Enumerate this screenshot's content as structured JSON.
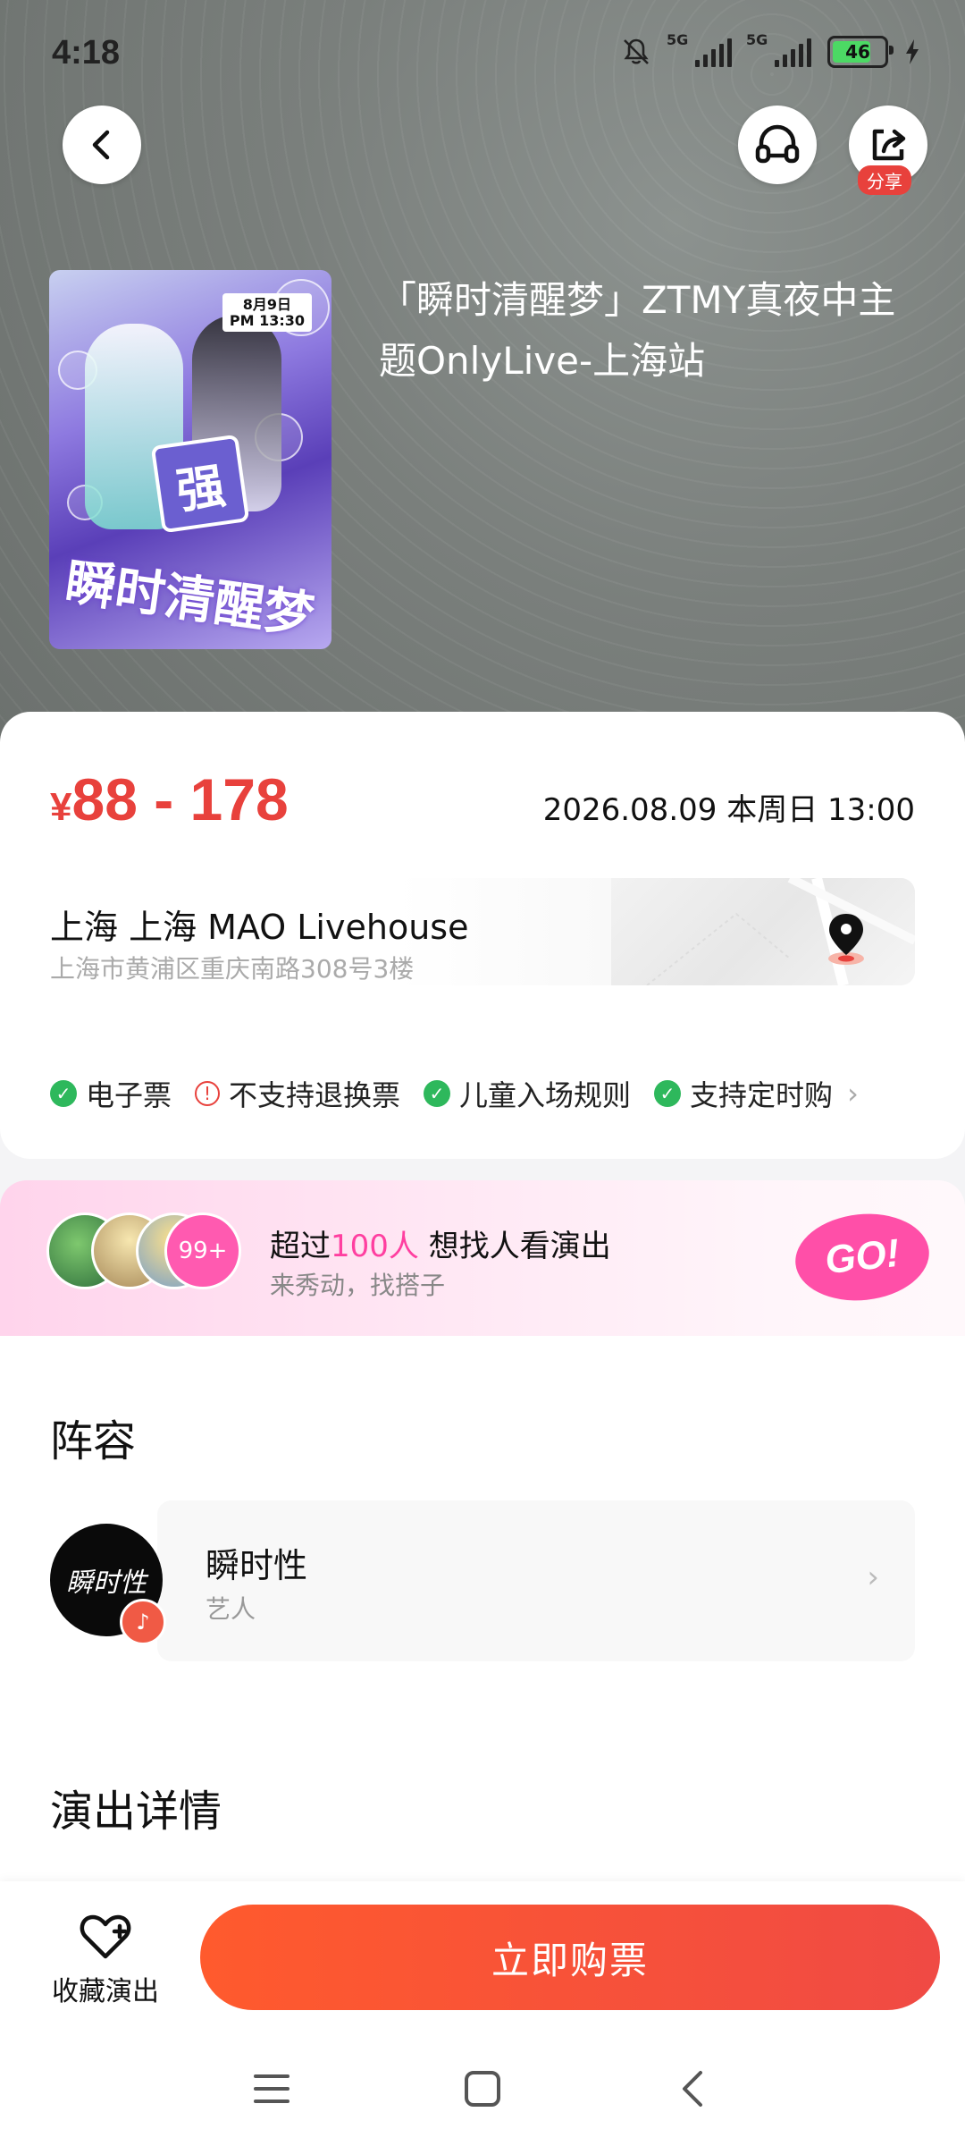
{
  "status_bar": {
    "time": "4:18",
    "signal1_label": "5G",
    "signal2_label": "5G",
    "battery_level": "46"
  },
  "header": {
    "share_label": "分享"
  },
  "event": {
    "title": "「瞬时清醒梦」ZTMY真夜中主题OnlyLive-上海站",
    "poster_text": "瞬时清醒梦",
    "poster_date_tag": "8月9日\nPM 13:30",
    "price_symbol": "¥",
    "price_range": "88 - 178",
    "datetime": "2026.08.09 本周日 13:00",
    "venue_name": "上海  上海 MAO Livehouse",
    "venue_address": "上海市黄浦区重庆南路308号3楼",
    "tags": [
      {
        "icon": "check-icon",
        "label": "电子票"
      },
      {
        "icon": "warning-icon",
        "label": "不支持退换票"
      },
      {
        "icon": "check-icon",
        "label": "儿童入场规则"
      },
      {
        "icon": "check-icon",
        "label": "支持定时购"
      }
    ]
  },
  "buddy": {
    "count_badge": "99+",
    "line1_prefix": "超过",
    "line1_highlight": "100人",
    "line1_suffix": " 想找人看演出",
    "line2": "来秀动，找搭子",
    "go_label": "GO!"
  },
  "lineup": {
    "heading": "阵容",
    "artist_name": "瞬时性",
    "artist_role": "艺人",
    "artist_avatar_text": "瞬时性"
  },
  "details": {
    "heading": "演出详情"
  },
  "bottom": {
    "favorite_label": "收藏演出",
    "buy_label": "立即购票"
  },
  "colors": {
    "accent_red": "#e8413c",
    "buy_gradient_start": "#ff5a2d",
    "pink": "#ff4fa8",
    "check_green": "#2eb85c"
  }
}
